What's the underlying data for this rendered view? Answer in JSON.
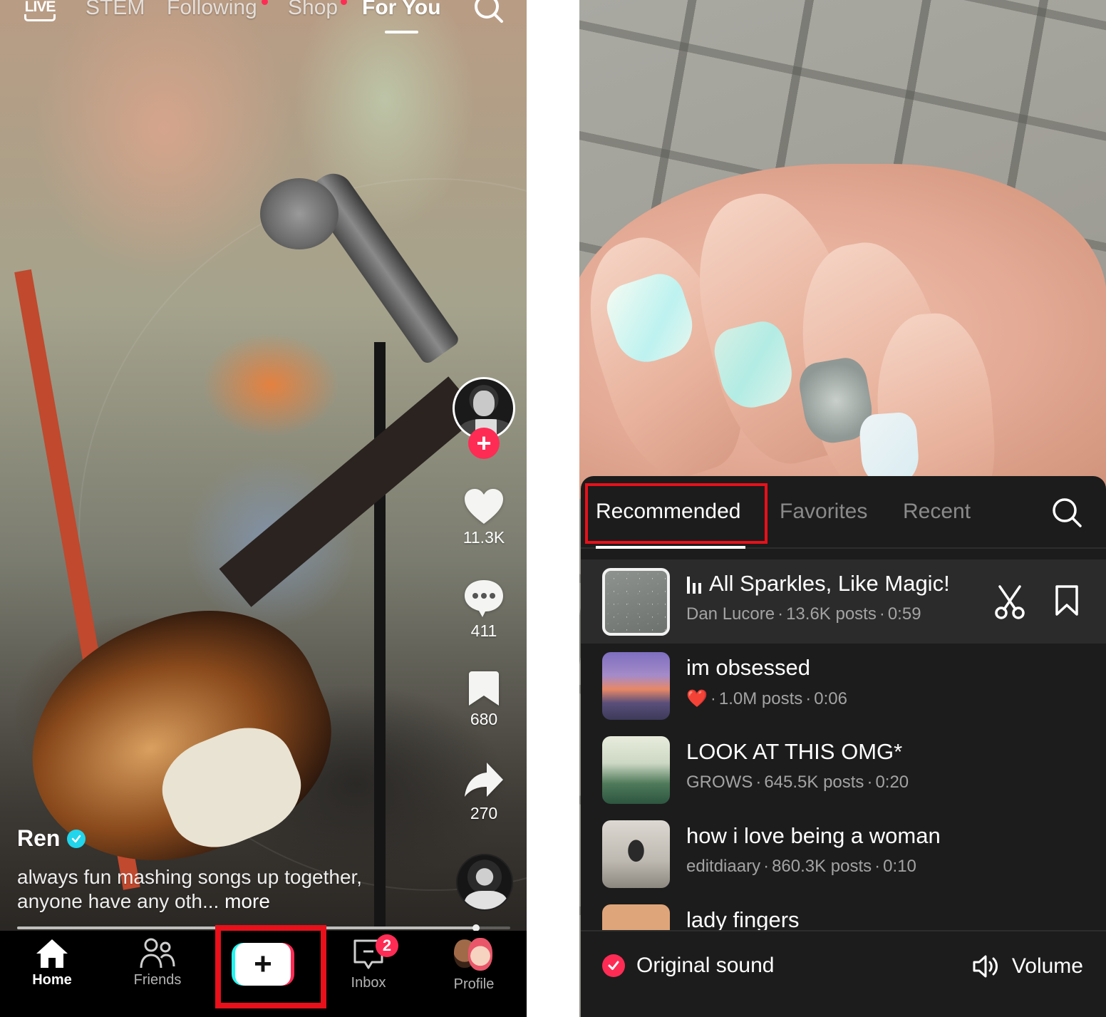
{
  "left": {
    "top_nav": {
      "live_label": "LIVE",
      "tabs": [
        {
          "label": "STEM",
          "active": false,
          "dot": false
        },
        {
          "label": "Following",
          "active": false,
          "dot": true
        },
        {
          "label": "Shop",
          "active": false,
          "dot": true
        },
        {
          "label": "For You",
          "active": true,
          "dot": false
        }
      ],
      "search_icon": "search-icon"
    },
    "actions": {
      "follow_icon": "plus-icon",
      "likes": "11.3K",
      "comments": "411",
      "bookmarks": "680",
      "shares": "270"
    },
    "post": {
      "author": "Ren",
      "verified": true,
      "caption": "always fun mashing songs up together, anyone have any oth...",
      "more_label": "more",
      "progress_percent": 93
    },
    "bottom_nav": {
      "items": [
        {
          "label": "Home",
          "icon": "home-icon",
          "active": true
        },
        {
          "label": "Friends",
          "icon": "friends-icon",
          "active": false
        },
        {
          "label": "",
          "icon": "create-plus-icon",
          "active": false
        },
        {
          "label": "Inbox",
          "icon": "inbox-icon",
          "active": false,
          "badge": "2"
        },
        {
          "label": "Profile",
          "icon": "profile-avatar-icon",
          "active": false
        }
      ]
    },
    "highlight_color": "#e8101a"
  },
  "right": {
    "tabs": [
      {
        "label": "Recommended",
        "active": true
      },
      {
        "label": "Favorites",
        "active": false
      },
      {
        "label": "Recent",
        "active": false
      }
    ],
    "sounds": [
      {
        "title": "All Sparkles, Like Magic!",
        "artist": "Dan Lucore",
        "posts": "13.6K posts",
        "duration": "0:59",
        "selected": true,
        "playing": true
      },
      {
        "title": "im obsessed",
        "artist": "❤️",
        "posts": "1.0M posts",
        "duration": "0:06",
        "selected": false
      },
      {
        "title": "LOOK AT THIS OMG*",
        "artist": "GROWS",
        "posts": "645.5K posts",
        "duration": "0:20",
        "selected": false
      },
      {
        "title": "how i love being a woman",
        "artist": "editdiaary",
        "posts": "860.3K posts",
        "duration": "0:10",
        "selected": false
      },
      {
        "title": "lady fingers",
        "artist": "",
        "posts": "",
        "duration": "",
        "selected": false
      }
    ],
    "footer": {
      "original_sound_label": "Original sound",
      "original_sound_checked": true,
      "volume_label": "Volume"
    },
    "accent_color": "#fe2c55"
  }
}
